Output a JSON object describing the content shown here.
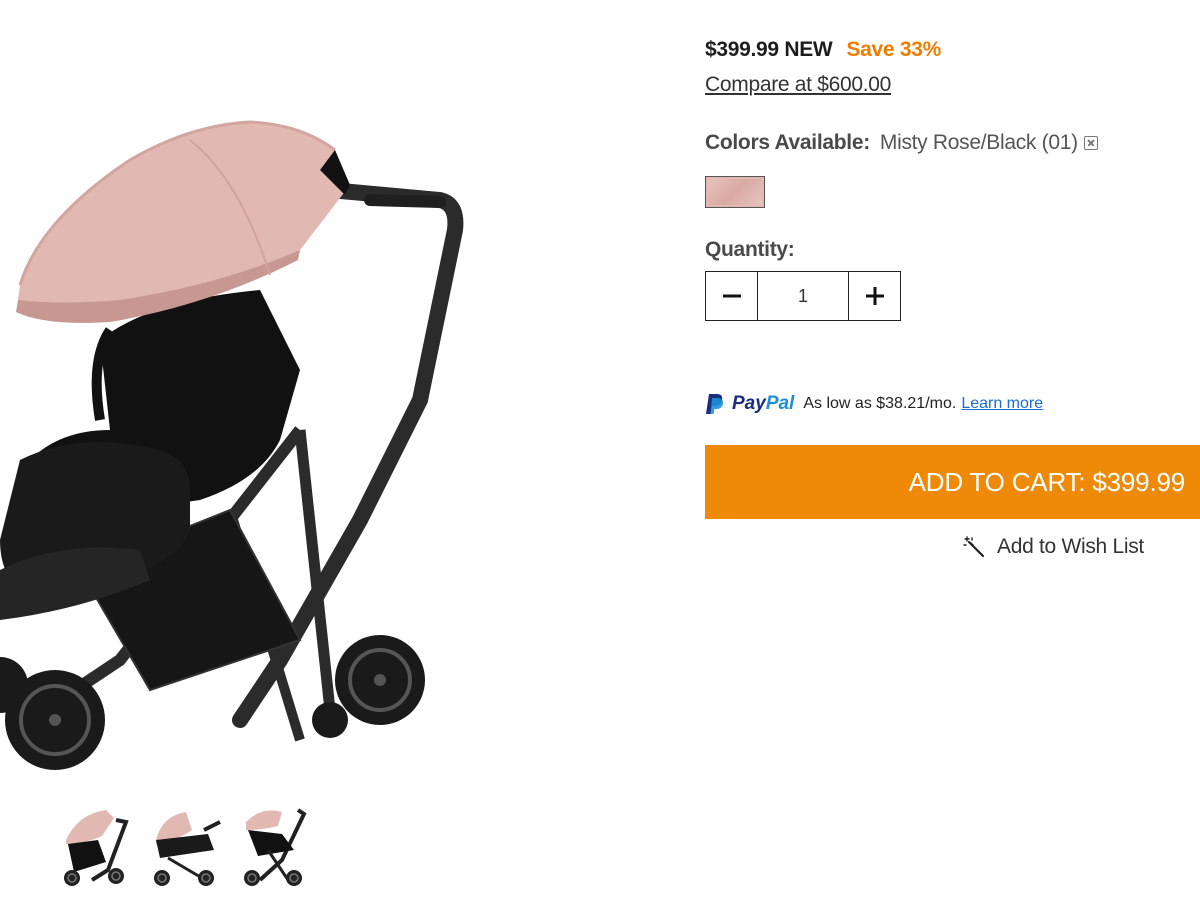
{
  "product": {
    "price": "$399.99 NEW",
    "save_text": "Save 33%",
    "compare_text": "Compare at $600.00",
    "colors_label": "Colors Available:",
    "color_value": "Misty Rose/Black (01)",
    "swatch_color": "#e1b8b2",
    "quantity_label": "Quantity:",
    "quantity_value": "1"
  },
  "paypal": {
    "brand_pay": "Pay",
    "brand_pal": "Pal",
    "text": "As low as $38.21/mo.",
    "link": "Learn more"
  },
  "actions": {
    "add_to_cart": "ADD TO CART: $399.99",
    "wishlist": "Add to Wish List"
  },
  "gallery": {
    "thumbnails": [
      "stroller-seat-view",
      "stroller-bassinet-view",
      "stroller-recline-view"
    ]
  },
  "colors": {
    "accent": "#ef8a08",
    "save": "#ef7d00",
    "paypal_dark": "#1a2e80",
    "paypal_light": "#1e8fd6",
    "link": "#1a6cd0"
  },
  "icons": {
    "clear": "clear-selection-icon",
    "minus": "minus-icon",
    "plus": "plus-icon",
    "paypal": "paypal-logo-icon",
    "wishlist": "magic-wand-icon"
  }
}
